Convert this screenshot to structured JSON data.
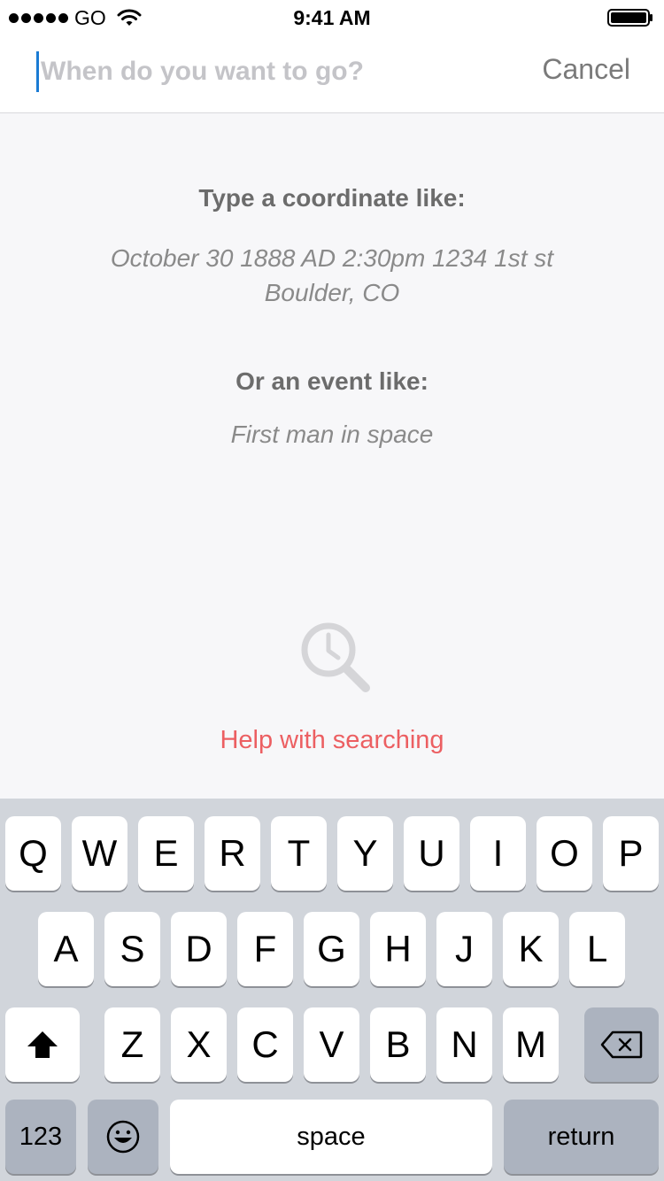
{
  "status_bar": {
    "carrier": "GO",
    "time": "9:41 AM"
  },
  "search": {
    "placeholder": "When do you want to go?",
    "value": "",
    "cancel_label": "Cancel"
  },
  "hints": {
    "coordinate_heading": "Type a coordinate like:",
    "coordinate_example_line1": "October 30 1888 AD 2:30pm 1234 1st st",
    "coordinate_example_line2": "Boulder, CO",
    "event_heading": "Or an event like:",
    "event_example": "First man in space"
  },
  "help_link": "Help with searching",
  "keyboard": {
    "row1": [
      "Q",
      "W",
      "E",
      "R",
      "T",
      "Y",
      "U",
      "I",
      "O",
      "P"
    ],
    "row2": [
      "A",
      "S",
      "D",
      "F",
      "G",
      "H",
      "J",
      "K",
      "L"
    ],
    "row3": [
      "Z",
      "X",
      "C",
      "V",
      "B",
      "N",
      "M"
    ],
    "numbers_key": "123",
    "space_key": "space",
    "return_key": "return"
  },
  "icons": {
    "signal": "signal-dots-icon",
    "wifi": "wifi-icon",
    "battery": "battery-icon",
    "search_clock": "search-clock-icon",
    "shift": "shift-arrow-icon",
    "backspace": "backspace-icon",
    "emoji": "emoji-icon"
  },
  "colors": {
    "caret": "#1a7bd4",
    "help_link": "#ec5f62",
    "keyboard_bg": "#d1d5db",
    "function_key": "#acb3bf"
  }
}
